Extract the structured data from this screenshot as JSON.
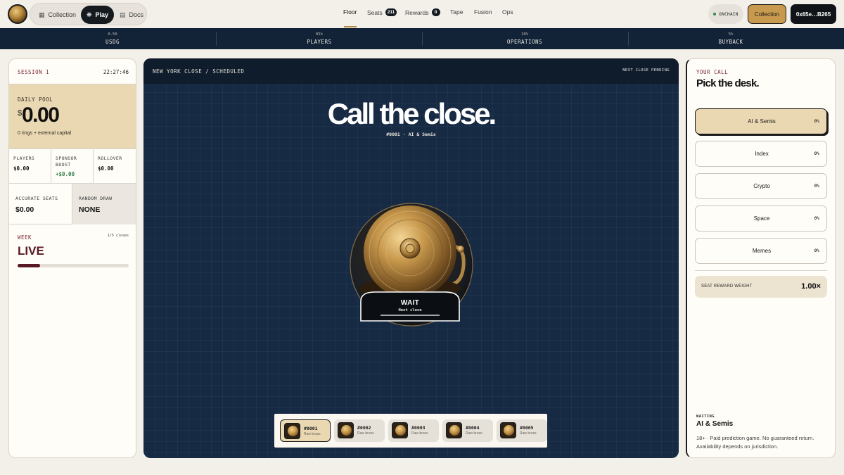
{
  "nav": {
    "pills": [
      {
        "label": "Collection",
        "icon": "collection-icon"
      },
      {
        "label": "Play",
        "icon": "sparkle-icon"
      },
      {
        "label": "Docs",
        "icon": "docs-icon"
      }
    ],
    "links": [
      {
        "label": "Floor"
      },
      {
        "label": "Seats",
        "badge": "211"
      },
      {
        "label": "Rewards",
        "badge": "0"
      },
      {
        "label": "Tape"
      },
      {
        "label": "Fusion"
      },
      {
        "label": "Ops"
      }
    ],
    "onchain_label": "ONCHAIN",
    "collection_button": "Collection",
    "wallet_button": "0x65e…B265"
  },
  "stats": [
    {
      "pct": "0.50",
      "label": "USDG"
    },
    {
      "pct": "85%",
      "label": "PLAYERS"
    },
    {
      "pct": "10%",
      "label": "OPERATIONS"
    },
    {
      "pct": "5%",
      "label": "BUYBACK"
    }
  ],
  "left": {
    "session": "SESSION 1",
    "time": "22:27:46",
    "pool_label": "DAILY POOL",
    "pool_currency": "$",
    "pool_amount": "0.00",
    "pool_sub": "0 rings + external capital",
    "players_label": "PLAYERS",
    "players_value": "$0.00",
    "sponsor_label_1": "SPONSOR",
    "sponsor_label_2": "BOOST",
    "sponsor_value": "+$0.00",
    "rollover_label": "ROLLOVER",
    "rollover_value": "$0.00",
    "accurate_label": "ACCURATE SEATS",
    "accurate_value": "$0.00",
    "draw_label": "RANDOM DRAW",
    "draw_value": "NONE",
    "week_label": "WEEK",
    "week_count": "1/5 closes",
    "week_status": "LIVE",
    "week_progress": 0.2
  },
  "stage": {
    "title": "NEW YORK CLOSE / SCHEDULED",
    "status": "NEXT CLOSE PENDING",
    "headline": "Call the close.",
    "subhead": "#0001 · AI & Semis",
    "wait_title": "WAIT",
    "wait_sub": "Next close",
    "tickets": [
      {
        "id": "#0001",
        "name": "Raw brass",
        "active": true
      },
      {
        "id": "#0002",
        "name": "Raw brass",
        "active": false
      },
      {
        "id": "#0003",
        "name": "Raw brass",
        "active": false
      },
      {
        "id": "#0004",
        "name": "Raw brass",
        "active": false
      },
      {
        "id": "#0005",
        "name": "Raw brass",
        "active": false
      }
    ]
  },
  "right": {
    "label": "YOUR CALL",
    "title": "Pick the desk.",
    "options": [
      {
        "name": "AI & Semis",
        "pct": "0%",
        "selected": true
      },
      {
        "name": "Index",
        "pct": "0%",
        "selected": false
      },
      {
        "name": "Crypto",
        "pct": "0%",
        "selected": false
      },
      {
        "name": "Space",
        "pct": "0%",
        "selected": false
      },
      {
        "name": "Memes",
        "pct": "0%",
        "selected": false
      }
    ],
    "weight_label": "SEAT REWARD WEIGHT",
    "weight_value": "1.00×",
    "waiting_label": "WAITING",
    "waiting_pick": "AI & Semis",
    "disclaimer": "18+ · Paid prediction game. No guaranteed return. Availability depends on jurisdiction."
  },
  "colors": {
    "navy": "#172a44",
    "brass": "#c89a4f",
    "sand": "#ead8b2",
    "maroon": "#5a1823"
  }
}
